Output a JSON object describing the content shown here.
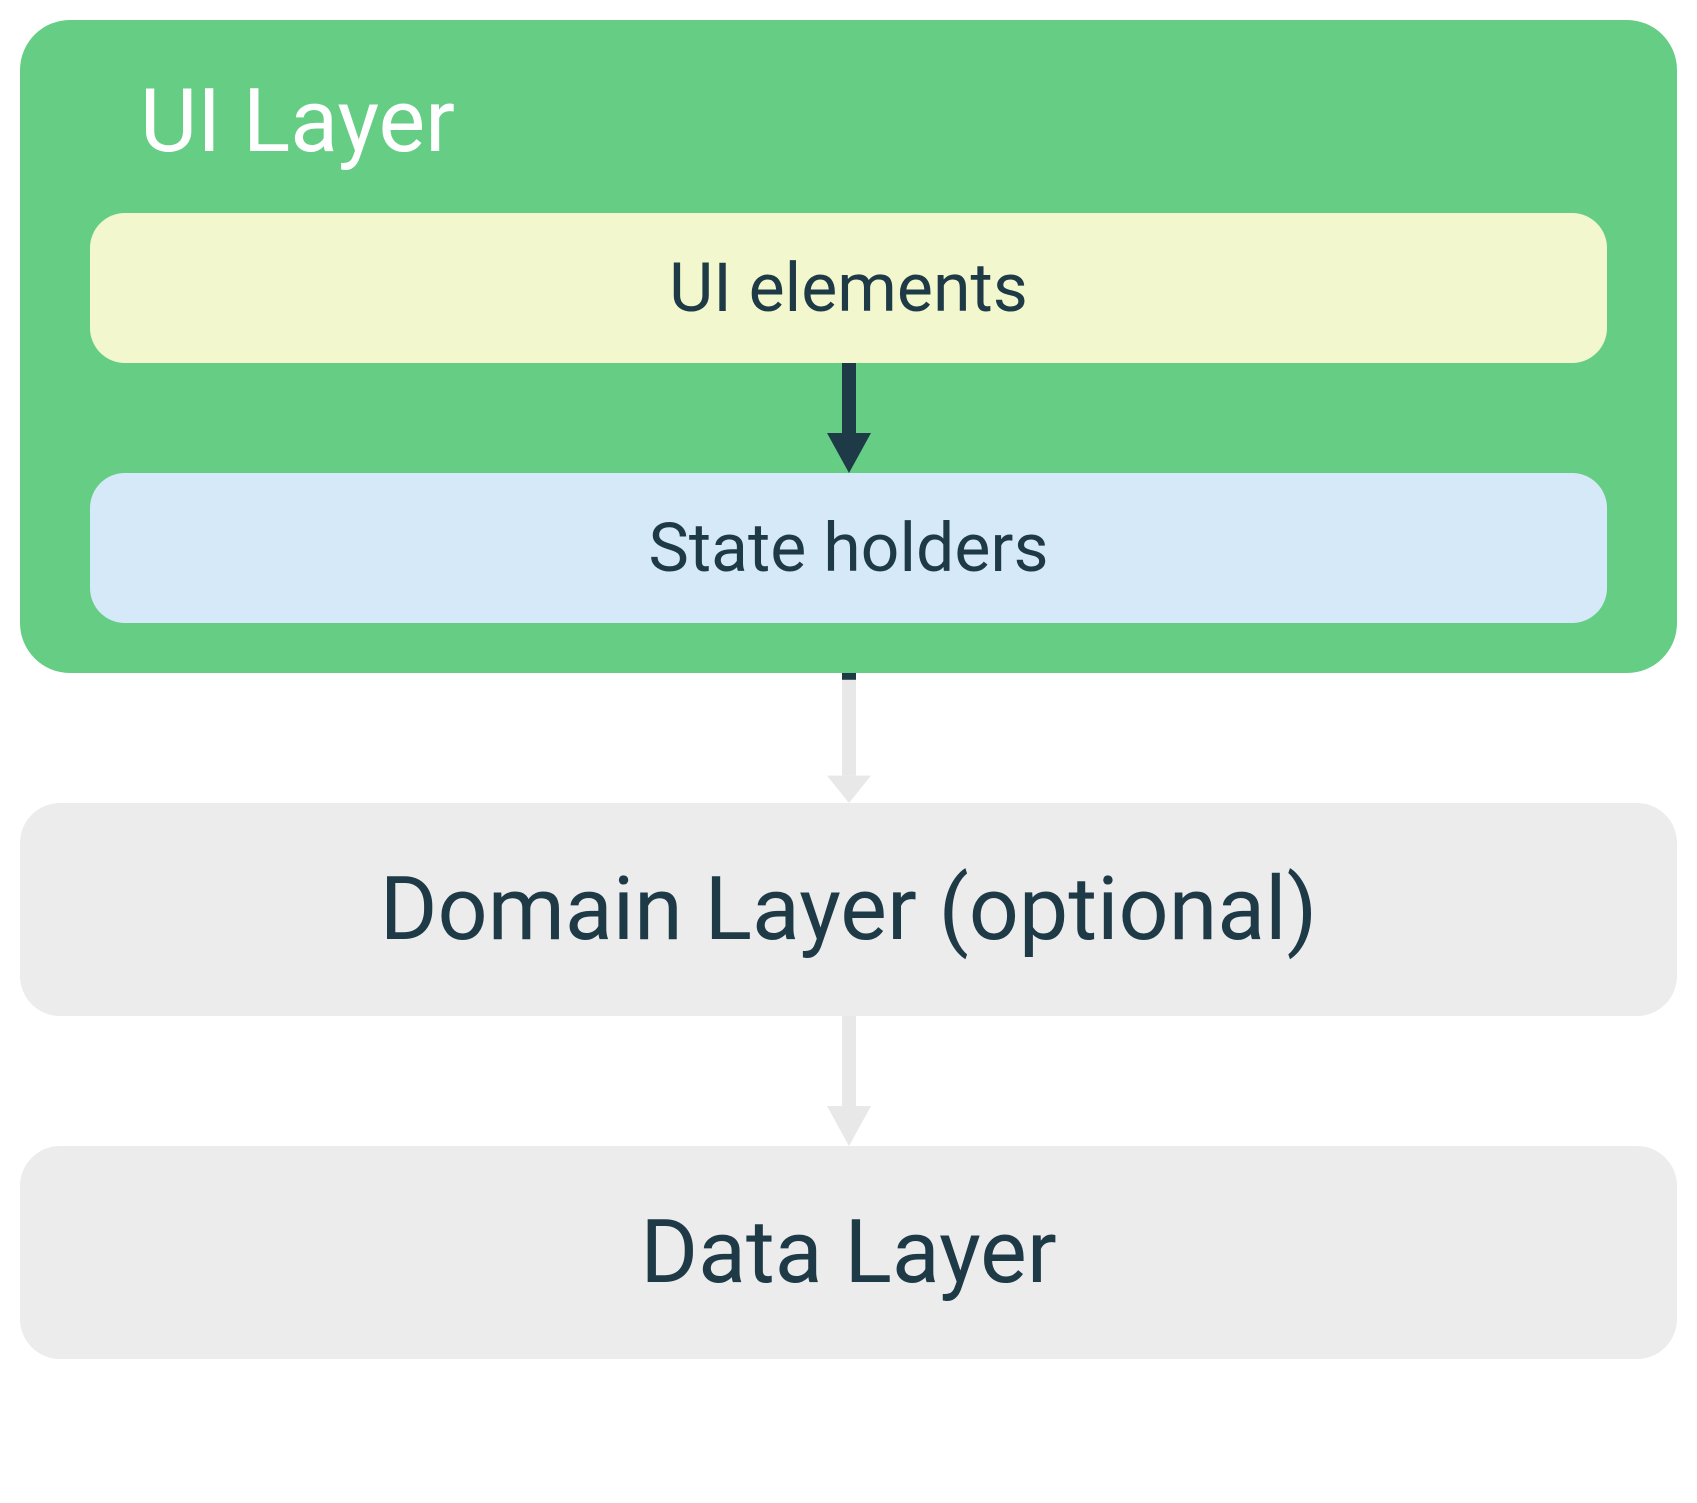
{
  "ui_layer": {
    "title": "UI Layer",
    "ui_elements_label": "UI elements",
    "state_holders_label": "State holders"
  },
  "domain_layer": {
    "label": "Domain Layer (optional)"
  },
  "data_layer": {
    "label": "Data Layer"
  },
  "colors": {
    "ui_layer_bg": "#65CE84",
    "ui_elements_bg": "#F3F7CD",
    "state_holders_bg": "#D5E9F8",
    "layer_box_bg": "#ECECEC",
    "text_dark": "#1E3A47",
    "text_light": "#ffffff",
    "arrow_dark": "#1E3A47",
    "arrow_light": "#E8E8E8"
  }
}
